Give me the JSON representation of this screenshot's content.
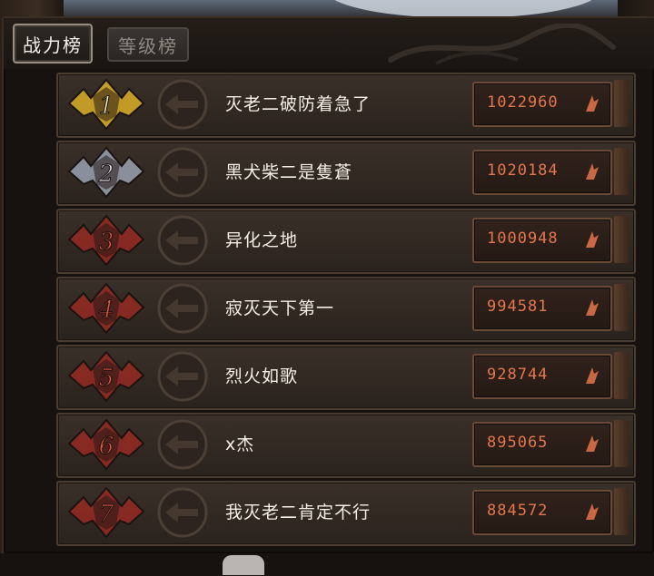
{
  "tabs": [
    {
      "label": "战力榜",
      "active": true
    },
    {
      "label": "等级榜",
      "active": false
    }
  ],
  "ranking": [
    {
      "rank": "1",
      "name": "灭老二破防着急了",
      "score": "1022960",
      "tier": "gold"
    },
    {
      "rank": "2",
      "name": "黑犬柴二是隻蒼",
      "score": "1020184",
      "tier": "silver"
    },
    {
      "rank": "3",
      "name": "异化之地",
      "score": "1000948",
      "tier": "red"
    },
    {
      "rank": "4",
      "name": "寂灭天下第一",
      "score": "994581",
      "tier": "red"
    },
    {
      "rank": "5",
      "name": "烈火如歌",
      "score": "928744",
      "tier": "red"
    },
    {
      "rank": "6",
      "name": "x杰",
      "score": "895065",
      "tier": "red"
    },
    {
      "rank": "7",
      "name": "我灭老二肯定不行",
      "score": "884572",
      "tier": "red"
    }
  ],
  "colors": {
    "gold": "#c9a227",
    "silver": "#8e96a3",
    "red": "#8b2a22",
    "score": "#e5764c"
  }
}
